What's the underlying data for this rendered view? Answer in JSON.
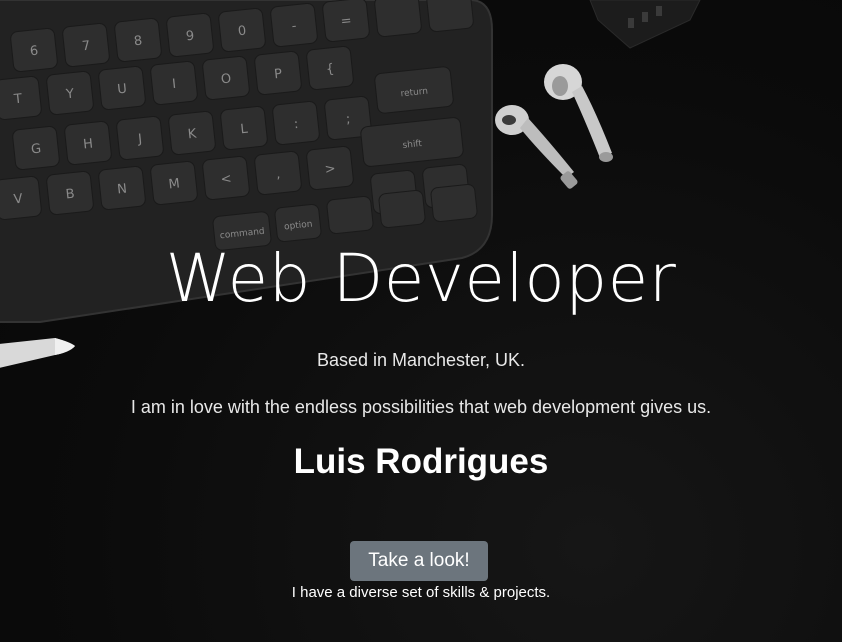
{
  "hero": {
    "title": "Web Developer",
    "location": "Based in Manchester, UK.",
    "tagline": "I am in love with the endless possibilities that web development gives us.",
    "name": "Luis Rodrigues",
    "cta_label": "Take a look!",
    "note": "I have a diverse set of skills & projects."
  },
  "keyboard": {
    "row_numbers": [
      "^",
      "6",
      "&",
      "7",
      "*",
      "8",
      "(",
      "9",
      ")",
      "0",
      "_",
      "-",
      "+",
      "="
    ],
    "row_top": [
      "T",
      "Y",
      "U",
      "I",
      "O",
      "P",
      "{",
      "[",
      "}",
      "]",
      "|",
      "\\"
    ],
    "row_mid": [
      "G",
      "H",
      "J",
      "K",
      "L",
      ":",
      ";",
      "\"",
      "'"
    ],
    "row_bottom": [
      "V",
      "B",
      "N",
      "M",
      "<",
      ",",
      ">",
      ".",
      "?",
      "/"
    ],
    "return_label": "return",
    "shift_label": "shift",
    "command_label": "command",
    "option_label": "option"
  },
  "colors": {
    "background": "#0d0d0d",
    "button": "#6c757d",
    "text": "#ffffff"
  }
}
